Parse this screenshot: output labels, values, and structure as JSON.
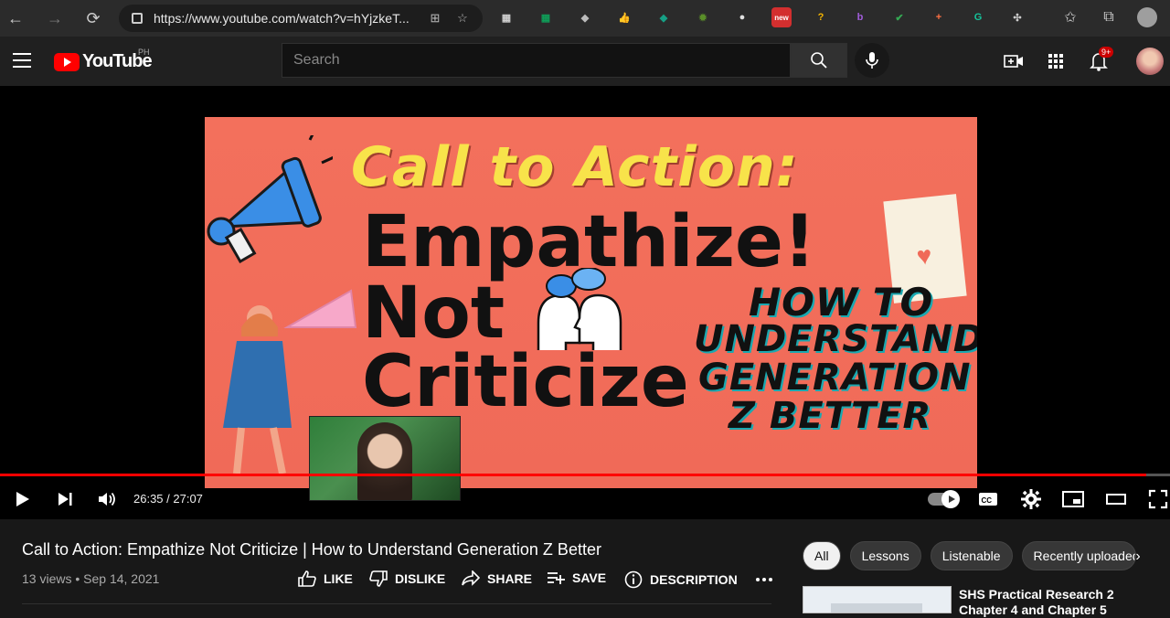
{
  "browser": {
    "url": "https://www.youtube.com/watch?v=hYjzkeT...",
    "extensions": [
      {
        "icon": "grid-icon",
        "color": "#cfcfcf",
        "text": "▦"
      },
      {
        "icon": "spreadsheet-icon",
        "color": "#0f9d58",
        "text": "▦"
      },
      {
        "icon": "bird-icon",
        "color": "#bbbbbb",
        "text": "◆"
      },
      {
        "icon": "thumbs-up-icon",
        "color": "#f4b400",
        "text": "👍"
      },
      {
        "icon": "shield-icon",
        "color": "#16a085",
        "text": "◆"
      },
      {
        "icon": "bug-icon",
        "color": "#5a8f29",
        "text": "✹"
      },
      {
        "icon": "music-icon",
        "color": "#e0e0e0",
        "text": "●"
      },
      {
        "icon": "new-icon",
        "color": "#d32f2f",
        "text": "new"
      },
      {
        "icon": "question-icon",
        "color": "#f4b400",
        "text": "?"
      },
      {
        "icon": "b-icon",
        "color": "#a25ddc",
        "text": "b"
      },
      {
        "icon": "check-icon",
        "color": "#34a853",
        "text": "✔"
      },
      {
        "icon": "plus-circle-icon",
        "color": "#ff7043",
        "text": "+"
      },
      {
        "icon": "grammarly-icon",
        "color": "#15c39a",
        "text": "G"
      },
      {
        "icon": "puzzle-icon",
        "color": "#cccccc",
        "text": "✣"
      }
    ]
  },
  "header": {
    "logo_text": "YouTube",
    "region": "PH",
    "search_placeholder": "Search",
    "notification_count": "9+"
  },
  "player": {
    "thumbnail": {
      "headline": "Call to Action:",
      "line1": "Empathize!",
      "line2": "Not",
      "line3": "Criticize",
      "side1": "HOW TO",
      "side2": "UNDERSTAND",
      "side3": "GENERATION",
      "side4": "Z BETTER"
    },
    "time": "26:35 / 27:07",
    "progress_fraction": 0.98
  },
  "video": {
    "title": "Call to Action: Empathize Not Criticize | How to Understand Generation Z Better",
    "meta": "13 views • Sep 14, 2021",
    "actions": {
      "like": "LIKE",
      "dislike": "DISLIKE",
      "share": "SHARE",
      "save": "SAVE",
      "description": "DESCRIPTION"
    }
  },
  "chips": [
    "All",
    "Lessons",
    "Listenable",
    "Recently uploaded"
  ],
  "recommended": {
    "title": "SHS Practical Research 2 Chapter 4 and Chapter 5"
  },
  "colors": {
    "accent": "#ff0000",
    "background": "#181818",
    "thumbnail_bg": "#f06a58",
    "headline": "#f8e34a"
  }
}
